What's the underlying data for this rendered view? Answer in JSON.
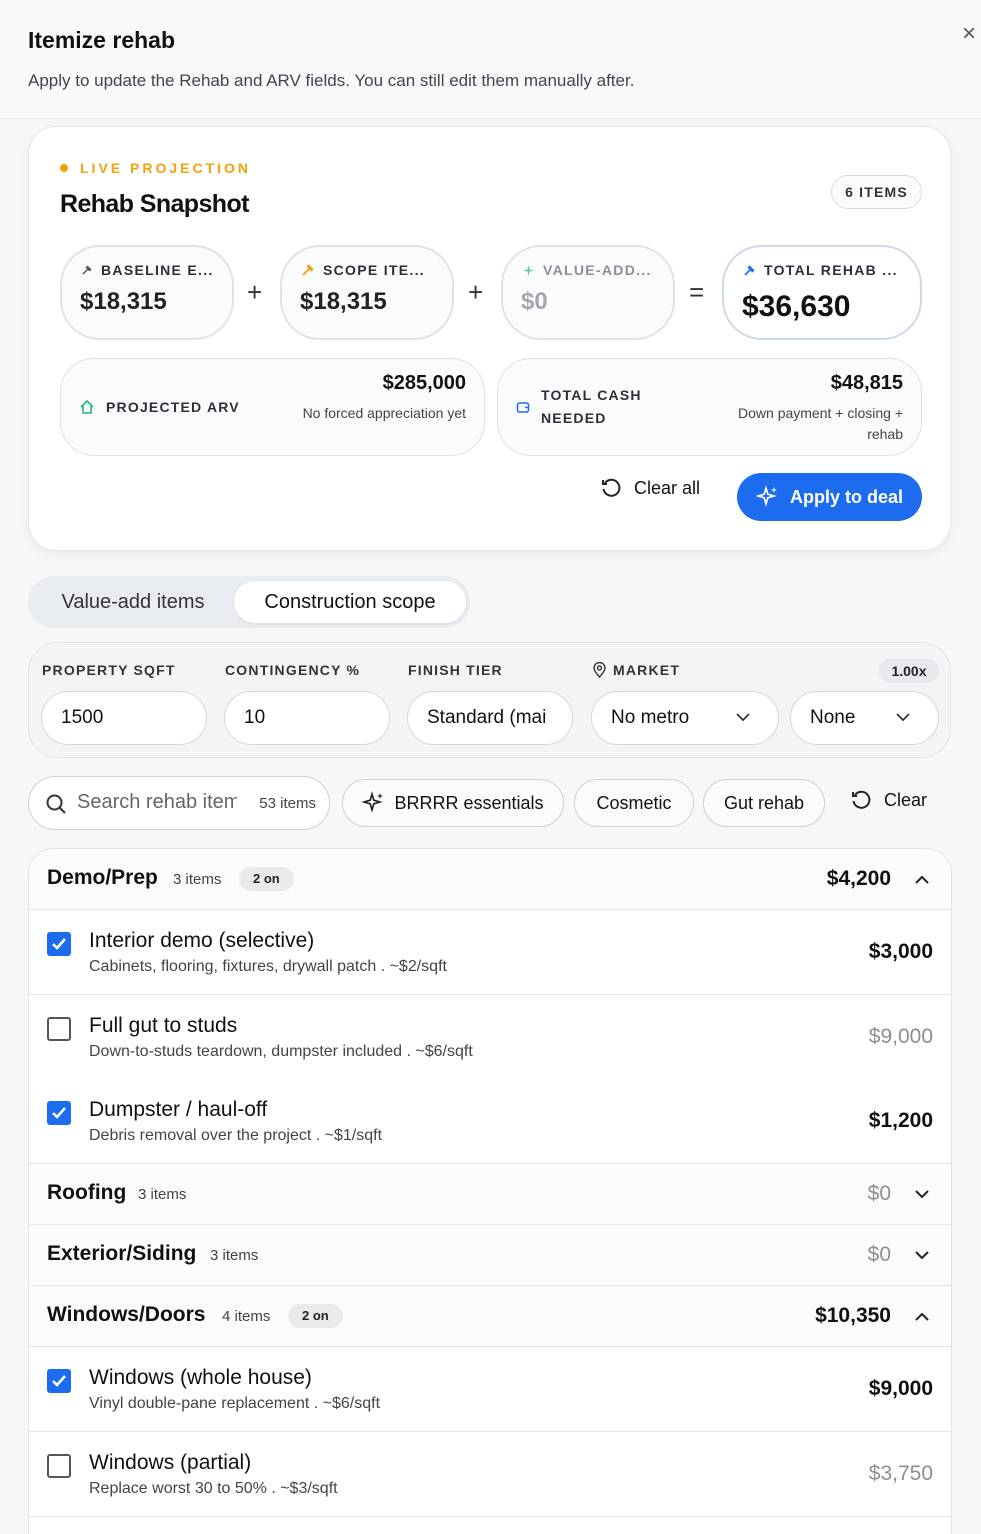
{
  "header": {
    "title": "Itemize rehab",
    "subtitle": "Apply to update the Rehab and ARV fields. You can still edit them manually after.",
    "close_glyph": "×"
  },
  "snapshot": {
    "eyebrow": "LIVE PROJECTION",
    "title": "Rehab Snapshot",
    "items_badge": "6 ITEMS",
    "baseline": {
      "label": "BASELINE E...",
      "value": "$18,315"
    },
    "scope": {
      "label": "SCOPE ITE...",
      "value": "$18,315"
    },
    "value_add": {
      "label": "VALUE-ADD...",
      "value": "$0"
    },
    "total": {
      "label": "TOTAL REHAB ...",
      "value": "$36,630"
    },
    "ops": {
      "plus": "+",
      "equals": "="
    },
    "arv": {
      "label": "PROJECTED ARV",
      "amount": "$285,000",
      "note": "No forced appreciation yet"
    },
    "cash": {
      "label_line1": "TOTAL CASH",
      "label_line2": "NEEDED",
      "amount": "$48,815",
      "note_line1": "Down payment + closing +",
      "note_line2": "rehab"
    },
    "clear_all": "Clear all",
    "apply": "Apply to deal"
  },
  "tabs": [
    {
      "label": "Value-add items",
      "active": false
    },
    {
      "label": "Construction scope",
      "active": true
    }
  ],
  "params": {
    "sqft_label": "PROPERTY SQFT",
    "sqft_value": "1500",
    "contingency_label": "CONTINGENCY %",
    "contingency_value": "10",
    "tier_label": "FINISH TIER",
    "tier_value": "Standard (mai",
    "market_label": "MARKET",
    "multiplier": "1.00x",
    "market_value": "No metro",
    "market2_value": "None"
  },
  "filters": {
    "search_placeholder": "Search rehab items",
    "count": "53 items",
    "chips": [
      "BRRRR essentials",
      "Cosmetic",
      "Gut rehab"
    ],
    "clear": "Clear"
  },
  "categories": [
    {
      "name": "Demo/Prep",
      "count": "3 items",
      "on": "2 on",
      "total": "$4,200",
      "expanded": true,
      "items": [
        {
          "name": "Interior demo (selective)",
          "desc": "Cabinets, flooring, fixtures, drywall patch . ~$2/sqft",
          "price": "$3,000",
          "checked": true
        },
        {
          "name": "Full gut to studs",
          "desc": "Down-to-studs teardown, dumpster included . ~$6/sqft",
          "price": "$9,000",
          "checked": false
        },
        {
          "name": "Dumpster / haul-off",
          "desc": "Debris removal over the project . ~$1/sqft",
          "price": "$1,200",
          "checked": true
        }
      ]
    },
    {
      "name": "Roofing",
      "count": "3 items",
      "on": "",
      "total": "$0",
      "expanded": false
    },
    {
      "name": "Exterior/Siding",
      "count": "3 items",
      "on": "",
      "total": "$0",
      "expanded": false
    },
    {
      "name": "Windows/Doors",
      "count": "4 items",
      "on": "2 on",
      "total": "$10,350",
      "expanded": true,
      "items": [
        {
          "name": "Windows (whole house)",
          "desc": "Vinyl double-pane replacement . ~$6/sqft",
          "price": "$9,000",
          "checked": true
        },
        {
          "name": "Windows (partial)",
          "desc": "Replace worst 30 to 50% . ~$3/sqft",
          "price": "$3,750",
          "checked": false
        }
      ]
    }
  ],
  "colors": {
    "accent": "#1d6cf0",
    "live": "#f5a10a",
    "progress": "#34d399"
  }
}
